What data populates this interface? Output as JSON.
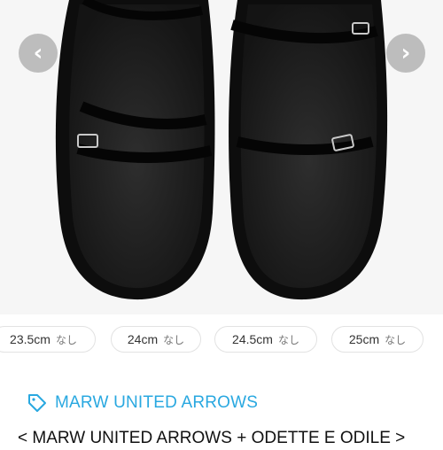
{
  "gallery": {
    "prev_icon": "chevron-left-icon",
    "next_icon": "chevron-right-icon",
    "prev_glyph": "‹",
    "next_glyph": "›",
    "image_subject": "black strap sandals with buckles, top view"
  },
  "sizes": [
    {
      "size": "23.5cm",
      "availability": "なし"
    },
    {
      "size": "24cm",
      "availability": "なし"
    },
    {
      "size": "24.5cm",
      "availability": "なし"
    },
    {
      "size": "25cm",
      "availability": "なし"
    }
  ],
  "brand": {
    "icon": "tag-icon",
    "name": "MARW UNITED ARROWS",
    "color": "#29a8e0"
  },
  "product": {
    "title": "< MARW UNITED ARROWS + ODETTE E ODILE >"
  }
}
